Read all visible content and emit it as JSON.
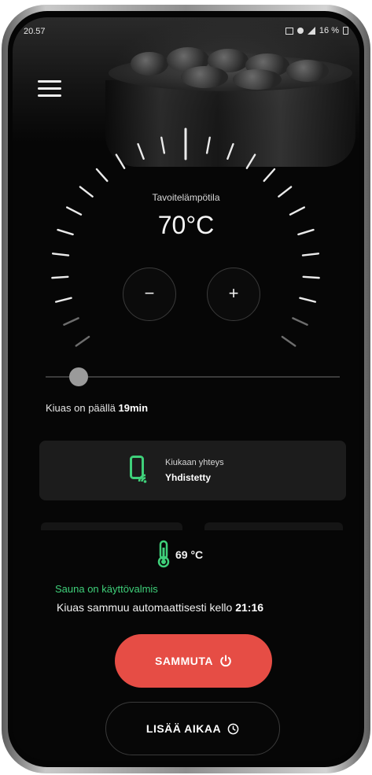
{
  "status_bar": {
    "time": "20.57",
    "battery": "16 %"
  },
  "menu": {
    "icon": "hamburger-menu-icon"
  },
  "dial": {
    "label": "Tavoitelämpötila",
    "value": "70°C",
    "minus_label": "−",
    "plus_label": "+"
  },
  "timer": {
    "position_fraction": 0.12,
    "on_prefix": "Kiuas on päällä",
    "on_value": "19min"
  },
  "connection": {
    "icon": "phone-wifi-icon",
    "title": "Kiukaan yhteys",
    "status": "Yhdistetty"
  },
  "temperature": {
    "icon": "thermometer-icon",
    "value": "69 °C"
  },
  "ready_text": "Sauna on käyttövalmis",
  "auto_off": {
    "text": "Kiuas sammuu automaattisesti kello",
    "time": "21:16"
  },
  "buttons": {
    "stop_label": "SAMMUTA",
    "stop_icon": "power-icon",
    "add_time_label": "LISÄÄ AIKAA",
    "add_time_icon": "clock-icon"
  },
  "colors": {
    "accent_red": "#e64d45",
    "ready_green": "#3fd07a",
    "background": "#060606"
  }
}
